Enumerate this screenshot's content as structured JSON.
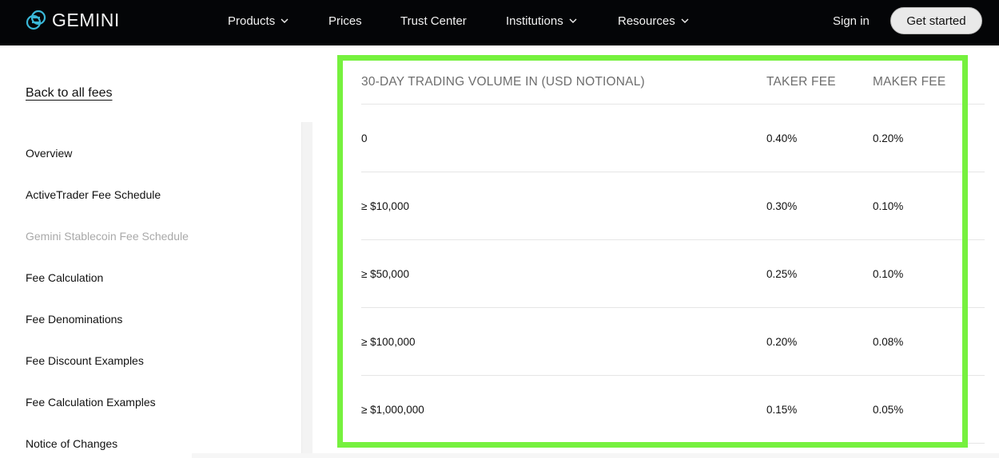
{
  "header": {
    "brand": "GEMINI",
    "nav": [
      {
        "label": "Products",
        "has_dropdown": true
      },
      {
        "label": "Prices",
        "has_dropdown": false
      },
      {
        "label": "Trust Center",
        "has_dropdown": false
      },
      {
        "label": "Institutions",
        "has_dropdown": true
      },
      {
        "label": "Resources",
        "has_dropdown": true
      }
    ],
    "sign_in": "Sign in",
    "get_started": "Get started",
    "colors": {
      "background": "#040507",
      "logo_accent": "#3ab8d8"
    }
  },
  "sidebar": {
    "back_link": "Back to all fees",
    "items": [
      {
        "label": "Overview",
        "active": false
      },
      {
        "label": "ActiveTrader Fee Schedule",
        "active": false
      },
      {
        "label": "Gemini Stablecoin Fee Schedule",
        "active": true
      },
      {
        "label": "Fee Calculation",
        "active": false
      },
      {
        "label": "Fee Denominations",
        "active": false
      },
      {
        "label": "Fee Discount Examples",
        "active": false
      },
      {
        "label": "Fee Calculation Examples",
        "active": false
      },
      {
        "label": "Notice of Changes",
        "active": false
      }
    ]
  },
  "fee_table": {
    "columns": [
      "30-DAY TRADING VOLUME IN (USD NOTIONAL)",
      "TAKER FEE",
      "MAKER FEE"
    ],
    "rows": [
      [
        "0",
        "0.40%",
        "0.20%"
      ],
      [
        "≥ $10,000",
        "0.30%",
        "0.10%"
      ],
      [
        "≥ $50,000",
        "0.25%",
        "0.10%"
      ],
      [
        "≥ $100,000",
        "0.20%",
        "0.08%"
      ],
      [
        "≥ $1,000,000",
        "0.15%",
        "0.05%"
      ]
    ],
    "highlight_color": "#76f13e"
  }
}
